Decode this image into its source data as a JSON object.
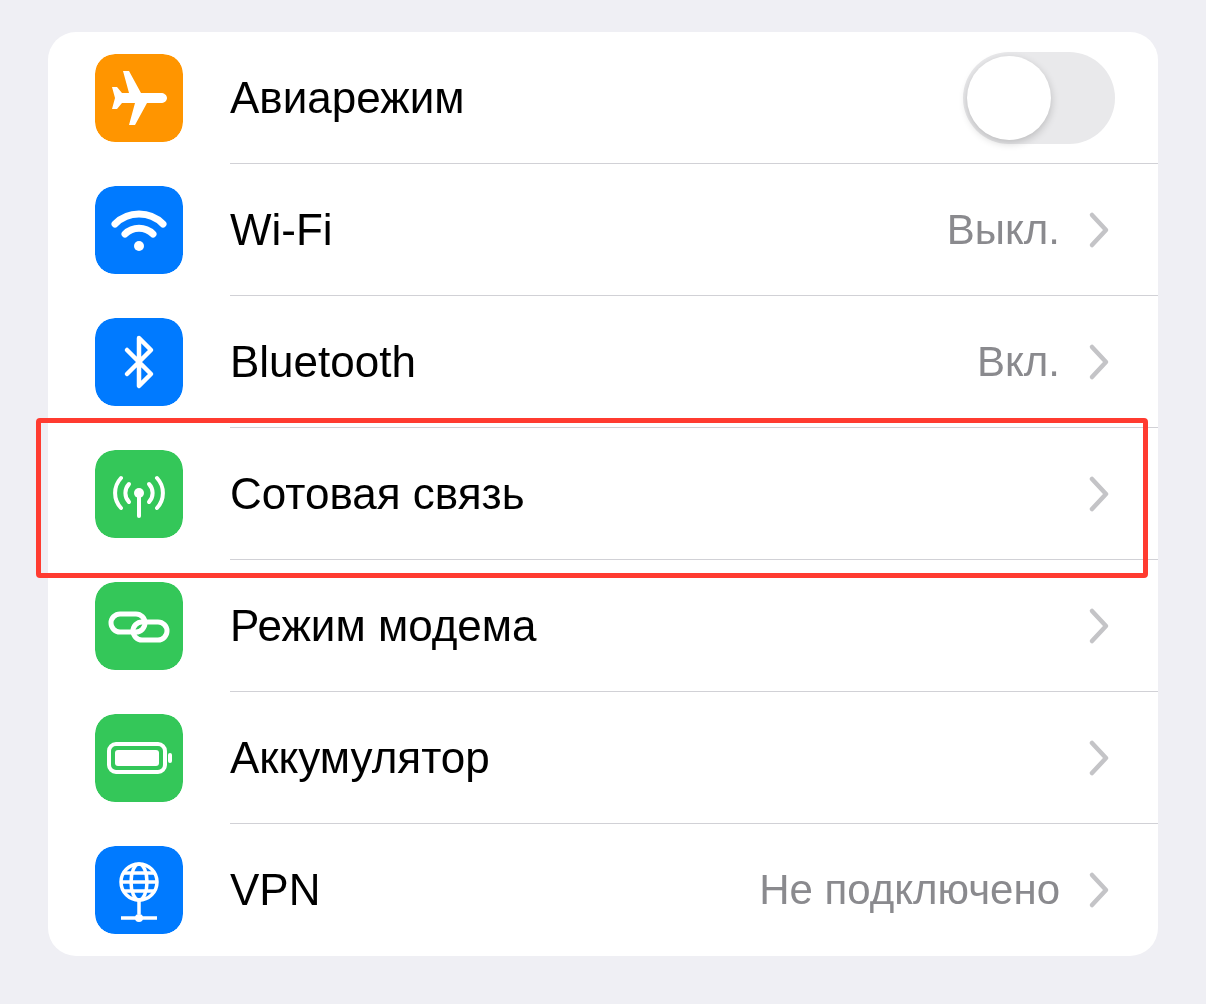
{
  "settings": [
    {
      "kind": "toggle",
      "label": "Авиарежим",
      "on": false,
      "highlighted": false
    },
    {
      "kind": "link",
      "label": "Wi-Fi",
      "value": "Выкл.",
      "highlighted": false
    },
    {
      "kind": "link",
      "label": "Bluetooth",
      "value": "Вкл.",
      "highlighted": false
    },
    {
      "kind": "link",
      "label": "Сотовая связь",
      "highlighted": true
    },
    {
      "kind": "link",
      "label": "Режим модема",
      "highlighted": false
    },
    {
      "kind": "link",
      "label": "Аккумулятор",
      "highlighted": false
    },
    {
      "kind": "link",
      "label": "VPN",
      "value": "Не подключено",
      "highlighted": false
    }
  ]
}
